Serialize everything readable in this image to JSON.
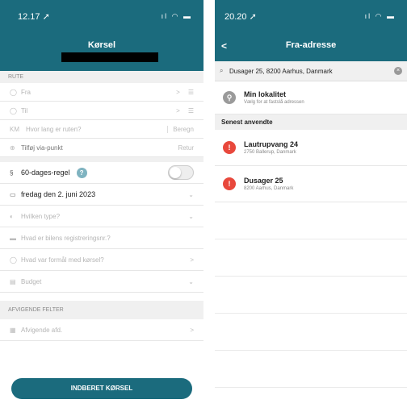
{
  "left": {
    "status": {
      "time": "12.17 ➚",
      "icons": "ıl ◠ ▬"
    },
    "nav": {
      "title": "Kørsel"
    },
    "section_rute": "RUTE",
    "from": {
      "placeholder": "Fra",
      "right": ">"
    },
    "to": {
      "placeholder": "Til",
      "right": ">"
    },
    "distance": {
      "prefix": "KM",
      "placeholder": "Hvor lang er ruten?",
      "action": "Beregn"
    },
    "via": {
      "label": "Tilføj via-punkt",
      "action": "Retur"
    },
    "rule60": {
      "label": "60-dages-regel",
      "help": "?"
    },
    "date": {
      "value": "fredag den 2. juni 2023"
    },
    "type": {
      "placeholder": "Hvilken type?"
    },
    "reg": {
      "placeholder": "Hvad er bilens registreringsnr.?"
    },
    "purpose": {
      "placeholder": "Hvad var formål med kørsel?"
    },
    "budget": {
      "placeholder": "Budget"
    },
    "section_afv": "AFVIGENDE FELTER",
    "dept": {
      "placeholder": "Afvigende afd."
    },
    "submit": "INDBERET KØRSEL"
  },
  "right": {
    "status": {
      "time": "20.20 ➚",
      "icons": "ıl ◠ ▬"
    },
    "nav": {
      "back": "<",
      "title": "Fra-adresse"
    },
    "search": {
      "value": "Dusager 25, 8200 Aarhus, Danmark",
      "clear": "×"
    },
    "my_location": {
      "title": "Min lokalitet",
      "subtitle": "Vælg for at fastslå adressen"
    },
    "recent_header": "Senest anvendte",
    "recent": [
      {
        "title": "Lautrupvang 24",
        "subtitle": "2750 Ballerup, Danmark"
      },
      {
        "title": "Dusager 25",
        "subtitle": "8200 Aarhus, Danmark"
      }
    ]
  },
  "colors": {
    "accent": "#1b6b7d",
    "pin": "#e8483c"
  }
}
